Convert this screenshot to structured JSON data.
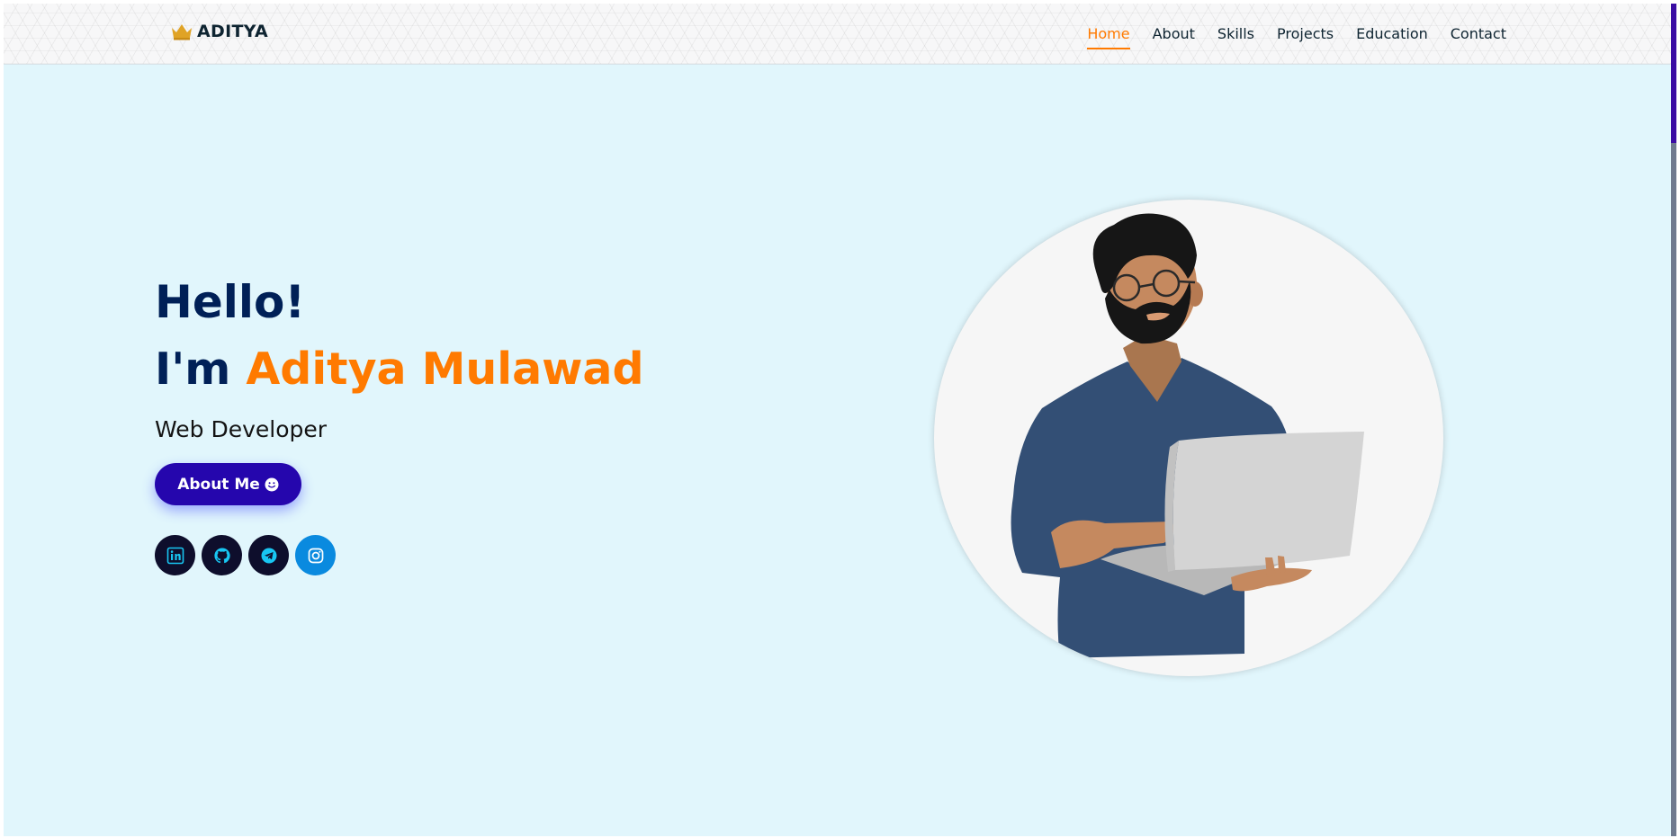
{
  "brand": {
    "name": "ADITYA",
    "icon": "crown-icon",
    "color": "#e0a325"
  },
  "nav": {
    "items": [
      "Home",
      "About",
      "Skills",
      "Projects",
      "Education",
      "Contact"
    ],
    "active": "Home",
    "active_color": "#ff7a00"
  },
  "hero": {
    "greeting": "Hello!",
    "intro_prefix": "I'm",
    "name": "Aditya Mulawad",
    "role": "Web Developer",
    "button_label": "About Me",
    "button_icon": "smile-icon",
    "name_color": "#ff7a00",
    "heading_color": "#002057",
    "button_color": "#2506ad"
  },
  "socials": [
    {
      "name": "linkedin-icon"
    },
    {
      "name": "github-icon"
    },
    {
      "name": "telegram-icon"
    },
    {
      "name": "instagram-icon"
    }
  ],
  "illustration": {
    "name": "developer-with-laptop-illustration"
  }
}
